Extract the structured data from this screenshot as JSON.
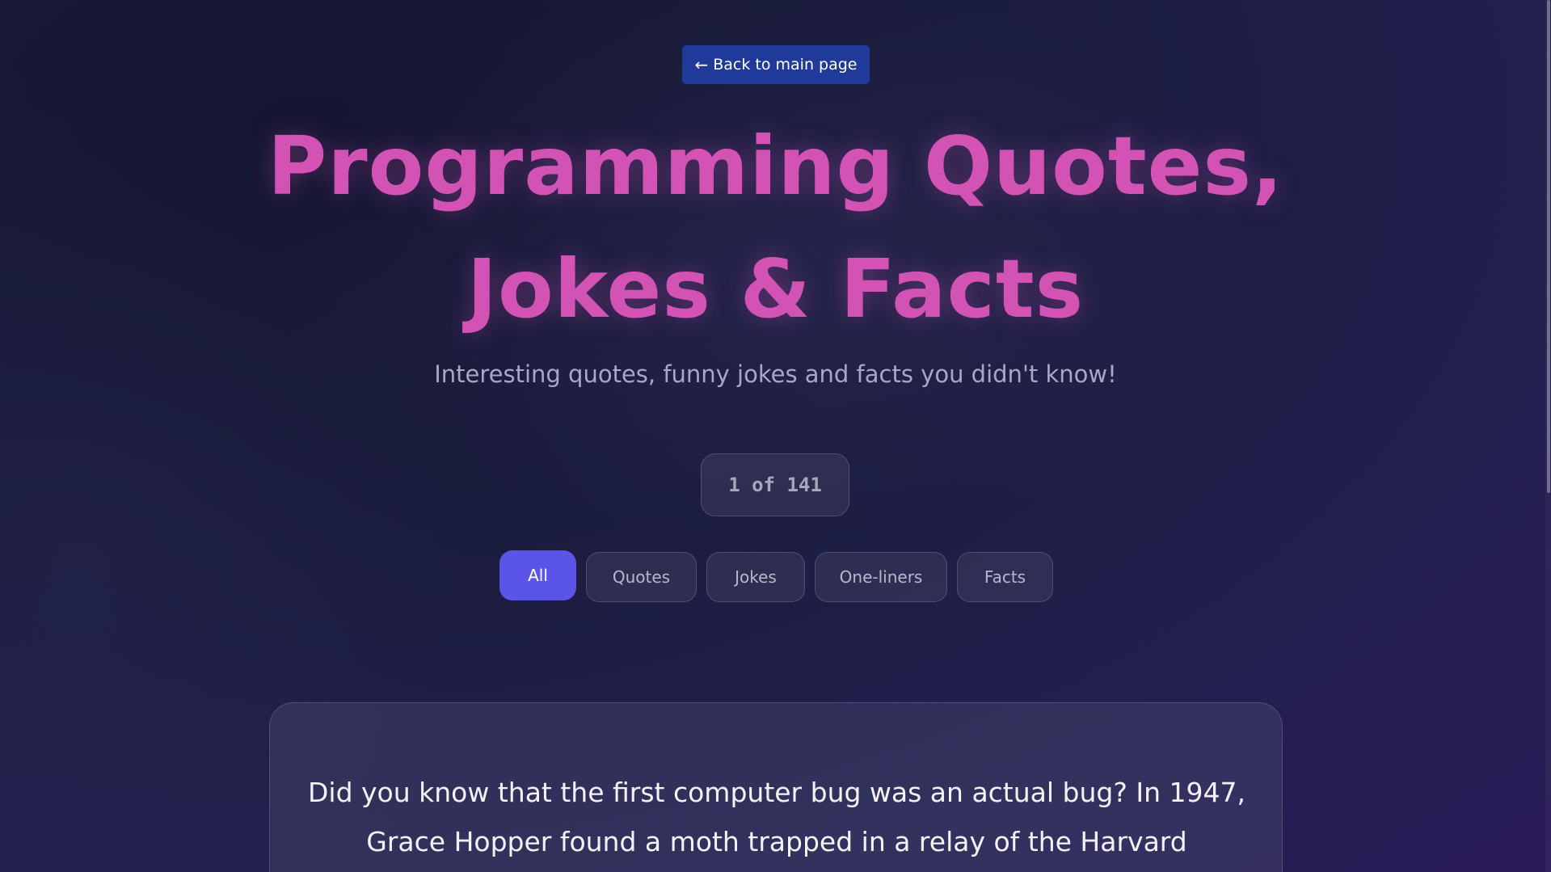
{
  "header": {
    "back_label": "Back to main page",
    "back_icon": "arrow-left-icon",
    "title_line1": "Programming Quotes,",
    "title_line2": "Jokes & Facts",
    "subtitle": "Interesting quotes, funny jokes and facts you didn't know!"
  },
  "counter": {
    "text": "1 of 141"
  },
  "filters": [
    {
      "label": "All",
      "active": true
    },
    {
      "label": "Quotes",
      "active": false
    },
    {
      "label": "Jokes",
      "active": false
    },
    {
      "label": "One-liners",
      "active": false
    },
    {
      "label": "Facts",
      "active": false
    }
  ],
  "card": {
    "text": "Did you know that the first computer bug was an actual bug? In 1947, Grace Hopper found a moth trapped in a relay of the Harvard"
  },
  "colors": {
    "accent": "#5a55e6",
    "title": "#d253b4",
    "back_button": "#1f3a9a"
  }
}
